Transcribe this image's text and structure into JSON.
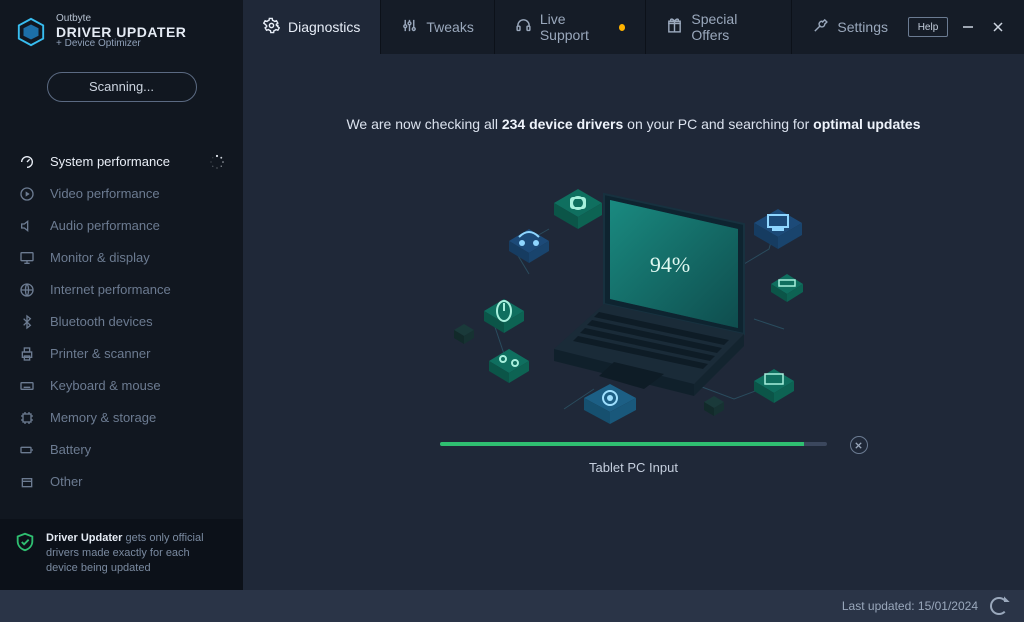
{
  "brand": {
    "small": "Outbyte",
    "big": "DRIVER UPDATER",
    "sub": "+ Device Optimizer"
  },
  "scan_button": "Scanning...",
  "tabs": {
    "diagnostics": "Diagnostics",
    "tweaks": "Tweaks",
    "live_support": "Live Support",
    "special_offers": "Special Offers",
    "settings": "Settings"
  },
  "help_label": "Help",
  "sidebar": {
    "items": [
      {
        "label": "System performance"
      },
      {
        "label": "Video performance"
      },
      {
        "label": "Audio performance"
      },
      {
        "label": "Monitor & display"
      },
      {
        "label": "Internet performance"
      },
      {
        "label": "Bluetooth devices"
      },
      {
        "label": "Printer & scanner"
      },
      {
        "label": "Keyboard & mouse"
      },
      {
        "label": "Memory & storage"
      },
      {
        "label": "Battery"
      },
      {
        "label": "Other"
      }
    ],
    "footer_bold": "Driver Updater",
    "footer_rest": " gets only official drivers made exactly for each device being updated"
  },
  "scan": {
    "prefix": "We are now checking all ",
    "count": "234 device drivers",
    "mid": " on your PC and searching for ",
    "suffix": "optimal updates",
    "percent_text": "94%",
    "percent_value": 94,
    "current_item": "Tablet PC Input"
  },
  "statusbar": {
    "last_updated": "Last updated: 15/01/2024"
  },
  "icons": {
    "system": "speedometer-icon",
    "video": "play-circle-icon",
    "audio": "speaker-icon",
    "monitor": "monitor-icon",
    "internet": "globe-icon",
    "bluetooth": "bluetooth-icon",
    "printer": "printer-icon",
    "keyboard": "keyboard-icon",
    "memory": "chip-icon",
    "battery": "battery-icon",
    "other": "box-icon",
    "shield": "shield-check-icon"
  },
  "colors": {
    "accent": "#ffb300",
    "progress": "#2fbf71"
  }
}
